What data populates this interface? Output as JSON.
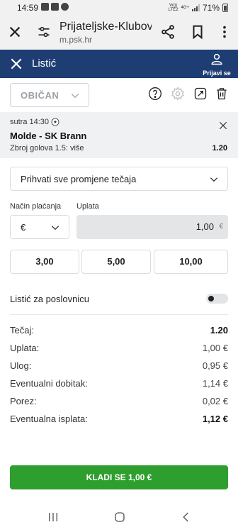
{
  "status_bar": {
    "time": "14:59",
    "network_top": "Vo))",
    "network_bottom": "LTE2",
    "network_type": "4G+",
    "battery": "71%"
  },
  "browser": {
    "page_title": "Prijateljske-Klubovi...",
    "url": "m.psk.hr",
    "icons": [
      "close-icon",
      "tune-icon",
      "share-icon",
      "bookmark-icon",
      "more-vert-icon"
    ]
  },
  "header": {
    "title": "Listić",
    "login_label": "Prijavi se",
    "bg_color": "#1e3e73"
  },
  "toolbar": {
    "bet_type": "OBIČAN",
    "icons": [
      "help-icon",
      "settings-icon",
      "share-ticket-icon",
      "trash-icon"
    ]
  },
  "event": {
    "time": "sutra 14:30",
    "match": "Molde - SK Brann",
    "market": "Zbroj golova 1.5: više",
    "odd": "1.20"
  },
  "odds_change": {
    "label": "Prihvati sve promjene tečaja"
  },
  "payment": {
    "method_label": "Način plaćanja",
    "amount_label": "Uplata",
    "currency": "€",
    "amount_value": "1,00",
    "amount_currency": "€"
  },
  "quick_amounts": [
    "3,00",
    "5,00",
    "10,00"
  ],
  "corporate": {
    "label": "Listić za poslovnicu",
    "enabled": false
  },
  "summary": [
    {
      "label": "Tečaj:",
      "value": "1.20",
      "bold": true
    },
    {
      "label": "Uplata:",
      "value": "1,00 €",
      "bold": false
    },
    {
      "label": "Ulog:",
      "value": "0,95 €",
      "bold": false
    },
    {
      "label": "Eventualni dobitak:",
      "value": "1,14 €",
      "bold": false
    },
    {
      "label": "Porez:",
      "value": "0,02 €",
      "bold": false
    },
    {
      "label": "Eventualna isplata:",
      "value": "1,12 €",
      "bold": true
    }
  ],
  "place_bet": {
    "label": "KLADI SE 1,00 €",
    "color": "#2e9e2e"
  },
  "nav": {
    "icons": [
      "recents-icon",
      "home-icon",
      "back-icon"
    ]
  }
}
